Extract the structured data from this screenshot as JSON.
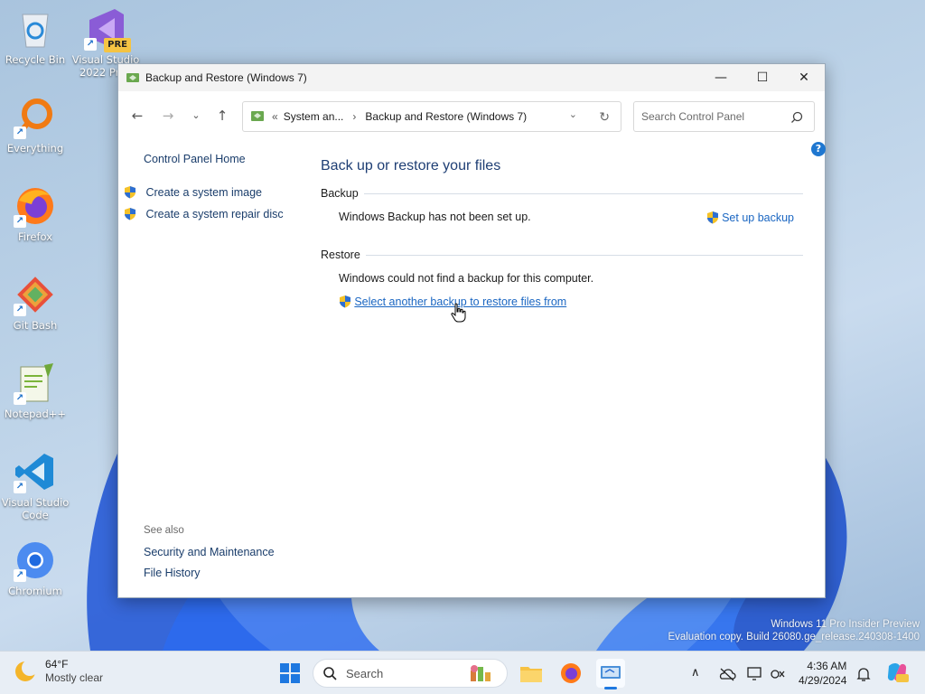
{
  "desktop": {
    "icons": [
      {
        "label": "Recycle Bin"
      },
      {
        "label": "Visual Studio 2022 Prev",
        "badge": "PRE"
      },
      {
        "label": "Everything"
      },
      {
        "label": "Firefox"
      },
      {
        "label": "Git Bash"
      },
      {
        "label": "Notepad++"
      },
      {
        "label": "Visual Studio Code"
      },
      {
        "label": "Chromium"
      }
    ],
    "watermark_line1": "Windows 11 Pro Insider Preview",
    "watermark_line2": "Evaluation copy. Build 26080.ge_release.240308-1400"
  },
  "window": {
    "title": "Backup and Restore (Windows 7)",
    "controls": {
      "minimize": "—",
      "maximize": "☐",
      "close": "✕"
    }
  },
  "address": {
    "chevron": "«",
    "crumb1": "System an...",
    "separator": "›",
    "crumb2": "Backup and Restore (Windows 7)"
  },
  "search": {
    "placeholder": "Search Control Panel"
  },
  "leftnav": {
    "home": "Control Panel Home",
    "tasks": [
      "Create a system image",
      "Create a system repair disc"
    ],
    "see_also_label": "See also",
    "see_also": [
      "Security and Maintenance",
      "File History"
    ]
  },
  "main": {
    "heading": "Back up or restore your files",
    "backup": {
      "label": "Backup",
      "status": "Windows Backup has not been set up.",
      "action": "Set up backup"
    },
    "restore": {
      "label": "Restore",
      "status": "Windows could not find a backup for this computer.",
      "action": "Select another backup to restore files from"
    }
  },
  "taskbar": {
    "weather_temp": "64°F",
    "weather_desc": "Mostly clear",
    "search_label": "Search",
    "time": "4:36 AM",
    "date": "4/29/2024"
  },
  "colors": {
    "link": "#1a66c2",
    "heading": "#1e3e74",
    "accent": "#1f77d0"
  }
}
